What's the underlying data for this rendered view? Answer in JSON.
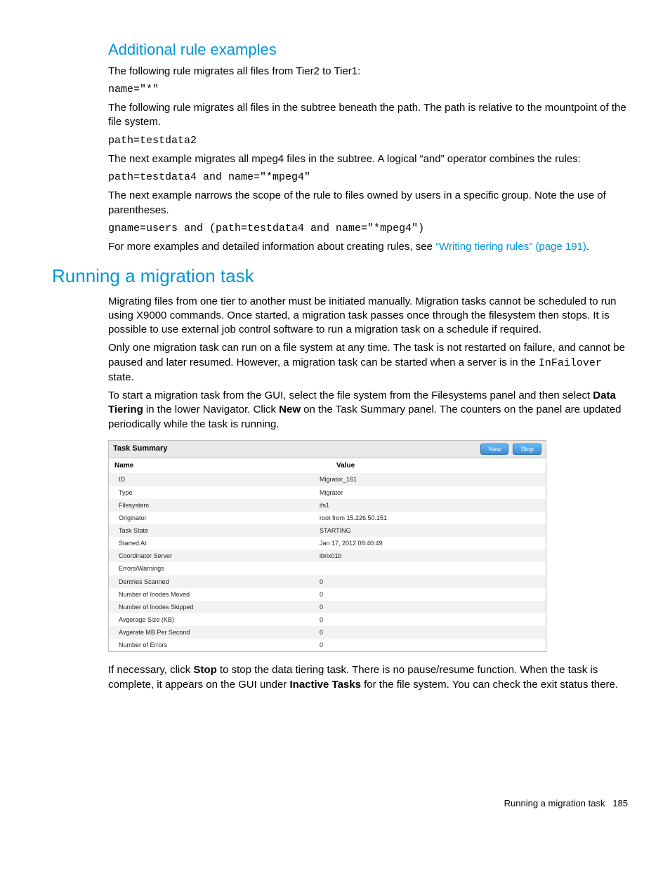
{
  "section1": {
    "title": "Additional rule examples",
    "p1": "The following rule migrates all files from Tier2 to Tier1:",
    "code1": "name=\"*\"",
    "p2": "The following rule migrates all files in the subtree beneath the path. The path is relative to the mountpoint of the file system.",
    "code2": "path=testdata2",
    "p3": "The next example migrates all mpeg4 files in the subtree. A logical “and” operator combines the rules:",
    "code3": "path=testdata4 and name=\"*mpeg4\"",
    "p4": "The next example narrows the scope of the rule to files owned by users in a specific group. Note the use of parentheses.",
    "code4": "gname=users and (path=testdata4 and name=\"*mpeg4\")",
    "p5a": "For more examples and detailed information about creating rules, see ",
    "link1": "“Writing tiering rules” (page 191)",
    "p5b": "."
  },
  "section2": {
    "title": "Running a migration task",
    "p1": "Migrating files from one tier to another must be initiated manually. Migration tasks cannot be scheduled to run using X9000 commands. Once started, a migration task passes once through the filesystem then stops. It is possible to use external job control software to run a migration task on a schedule if required.",
    "p2a": "Only one migration task can run on a file system at any time. The task is not restarted on failure, and cannot be paused and later resumed. However, a migration task can be started when a server is in the ",
    "p2code": "InFailover",
    "p2b": " state.",
    "p3a": "To start a migration task from the GUI, select the file system from the Filesystems panel and then select ",
    "p3bold1": "Data Tiering",
    "p3b": " in the lower Navigator. Click ",
    "p3bold2": "New",
    "p3c": " on the Task Summary panel. The counters on the panel are updated periodically while the task is running.",
    "p4a": "If necessary, click ",
    "p4bold1": "Stop",
    "p4b": " to stop the data tiering task. There is no pause/resume function. When the task is complete, it appears on the GUI under ",
    "p4bold2": "Inactive Tasks",
    "p4c": " for the file system. You can check the exit status there."
  },
  "panel": {
    "title": "Task Summary",
    "new_btn": "New",
    "stop_btn": "Stop",
    "col_name": "Name",
    "col_value": "Value",
    "rows": [
      {
        "name": "ID",
        "value": "Migrator_161"
      },
      {
        "name": "Type",
        "value": "Migrator"
      },
      {
        "name": "Filesystem",
        "value": "ifs1"
      },
      {
        "name": "Originator",
        "value": "root from 15.226.50.151"
      },
      {
        "name": "Task State",
        "value": "STARTING"
      },
      {
        "name": "Started At",
        "value": "Jan 17, 2012 08:40:49"
      },
      {
        "name": "Coordinator Server",
        "value": "ibrix01b"
      },
      {
        "name": "Errors/Warnings",
        "value": ""
      },
      {
        "name": "Dentries Scanned",
        "value": "0"
      },
      {
        "name": "Number of Inodes Moved",
        "value": "0"
      },
      {
        "name": "Number of Inodes Skipped",
        "value": "0"
      },
      {
        "name": "Avgerage Size (KB)",
        "value": "0"
      },
      {
        "name": "Avgerate MB Per Second",
        "value": "0"
      },
      {
        "name": "Number of Errors",
        "value": "0"
      }
    ]
  },
  "footer": {
    "text": "Running a migration task",
    "page": "185"
  }
}
